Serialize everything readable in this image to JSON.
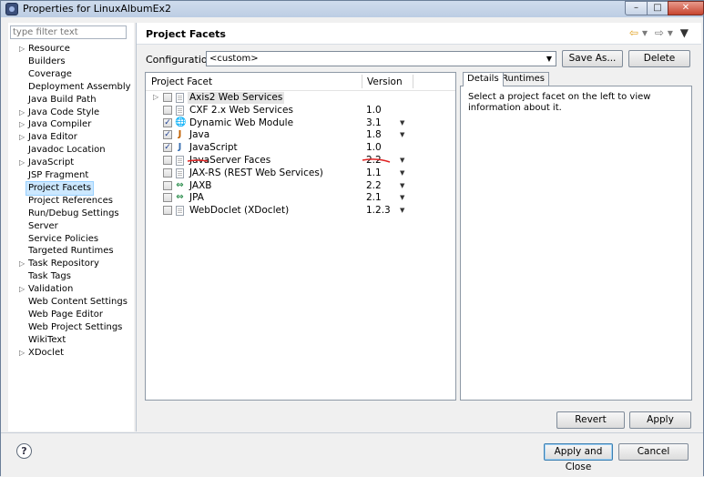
{
  "window": {
    "title": "Properties for LinuxAlbumEx2",
    "icon": "eclipse-icon",
    "controls": {
      "minimize": "–",
      "maximize": "□",
      "close": "✕"
    }
  },
  "filter": {
    "placeholder": "type filter text"
  },
  "tree": [
    {
      "label": "Resource",
      "expandable": true
    },
    {
      "label": "Builders",
      "expandable": false
    },
    {
      "label": "Coverage",
      "expandable": false
    },
    {
      "label": "Deployment Assembly",
      "expandable": false
    },
    {
      "label": "Java Build Path",
      "expandable": false
    },
    {
      "label": "Java Code Style",
      "expandable": true
    },
    {
      "label": "Java Compiler",
      "expandable": true
    },
    {
      "label": "Java Editor",
      "expandable": true
    },
    {
      "label": "Javadoc Location",
      "expandable": false
    },
    {
      "label": "JavaScript",
      "expandable": true
    },
    {
      "label": "JSP Fragment",
      "expandable": false
    },
    {
      "label": "Project Facets",
      "expandable": false,
      "selected": true
    },
    {
      "label": "Project References",
      "expandable": false
    },
    {
      "label": "Run/Debug Settings",
      "expandable": false
    },
    {
      "label": "Server",
      "expandable": false
    },
    {
      "label": "Service Policies",
      "expandable": false
    },
    {
      "label": "Targeted Runtimes",
      "expandable": false
    },
    {
      "label": "Task Repository",
      "expandable": true
    },
    {
      "label": "Task Tags",
      "expandable": false
    },
    {
      "label": "Validation",
      "expandable": true
    },
    {
      "label": "Web Content Settings",
      "expandable": false
    },
    {
      "label": "Web Page Editor",
      "expandable": false
    },
    {
      "label": "Web Project Settings",
      "expandable": false
    },
    {
      "label": "WikiText",
      "expandable": false
    },
    {
      "label": "XDoclet",
      "expandable": true
    }
  ],
  "page": {
    "title": "Project Facets",
    "configuration_label": "Configuration:",
    "configuration_value": "<custom>",
    "save_as": "Save As...",
    "delete": "Delete"
  },
  "facets": {
    "col_facet": "Project Facet",
    "col_version": "Version",
    "rows": [
      {
        "name": "Axis2 Web Services",
        "version": "",
        "checked": false,
        "expandable": true,
        "icon": "document-icon",
        "dropdown": false
      },
      {
        "name": "CXF 2.x Web Services",
        "version": "1.0",
        "checked": false,
        "icon": "document-icon",
        "dropdown": false
      },
      {
        "name": "Dynamic Web Module",
        "version": "3.1",
        "checked": true,
        "icon": "web-module-icon",
        "dropdown": true
      },
      {
        "name": "Java",
        "version": "1.8",
        "checked": true,
        "icon": "java-icon",
        "dropdown": true
      },
      {
        "name": "JavaScript",
        "version": "1.0",
        "checked": true,
        "icon": "javascript-icon",
        "dropdown": false
      },
      {
        "name": "JavaServer Faces",
        "version": "2.2",
        "checked": false,
        "icon": "document-icon",
        "dropdown": true
      },
      {
        "name": "JAX-RS (REST Web Services)",
        "version": "1.1",
        "checked": false,
        "icon": "document-icon",
        "dropdown": true
      },
      {
        "name": "JAXB",
        "version": "2.2",
        "checked": false,
        "icon": "jaxb-icon",
        "dropdown": true
      },
      {
        "name": "JPA",
        "version": "2.1",
        "checked": false,
        "icon": "jpa-icon",
        "dropdown": true
      },
      {
        "name": "WebDoclet (XDoclet)",
        "version": "1.2.3",
        "checked": false,
        "icon": "document-icon",
        "dropdown": true
      }
    ]
  },
  "details": {
    "tab_details": "Details",
    "tab_runtimes": "Runtimes",
    "text": "Select a project facet on the left to view information about it."
  },
  "buttons": {
    "revert": "Revert",
    "apply": "Apply",
    "apply_and_close": "Apply and Close",
    "cancel": "Cancel"
  },
  "help": "?",
  "colors": {
    "selection": "#cce8ff",
    "annotation": "#e02020"
  }
}
